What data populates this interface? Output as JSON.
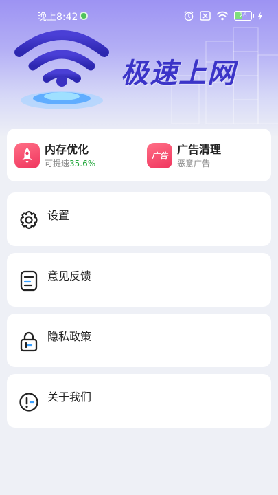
{
  "status_bar": {
    "time": "晚上8:42",
    "battery_level": "26"
  },
  "hero": {
    "title": "极速上网"
  },
  "quick_actions": [
    {
      "title": "内存优化",
      "subtitle_prefix": "可提速",
      "subtitle_highlight": "35.6%",
      "icon": "rocket-icon"
    },
    {
      "title": "广告清理",
      "subtitle": "恶意广告",
      "icon": "ad-icon",
      "icon_text": "广告"
    }
  ],
  "menu": [
    {
      "label": "设置",
      "icon": "gear-icon"
    },
    {
      "label": "意见反馈",
      "icon": "feedback-icon"
    },
    {
      "label": "隐私政策",
      "icon": "lock-icon"
    },
    {
      "label": "关于我们",
      "icon": "info-icon"
    }
  ],
  "colors": {
    "accent": "#3b34c8",
    "highlight_green": "#22a63b",
    "icon_red": "#f0355e",
    "background": "#eef0f6"
  }
}
